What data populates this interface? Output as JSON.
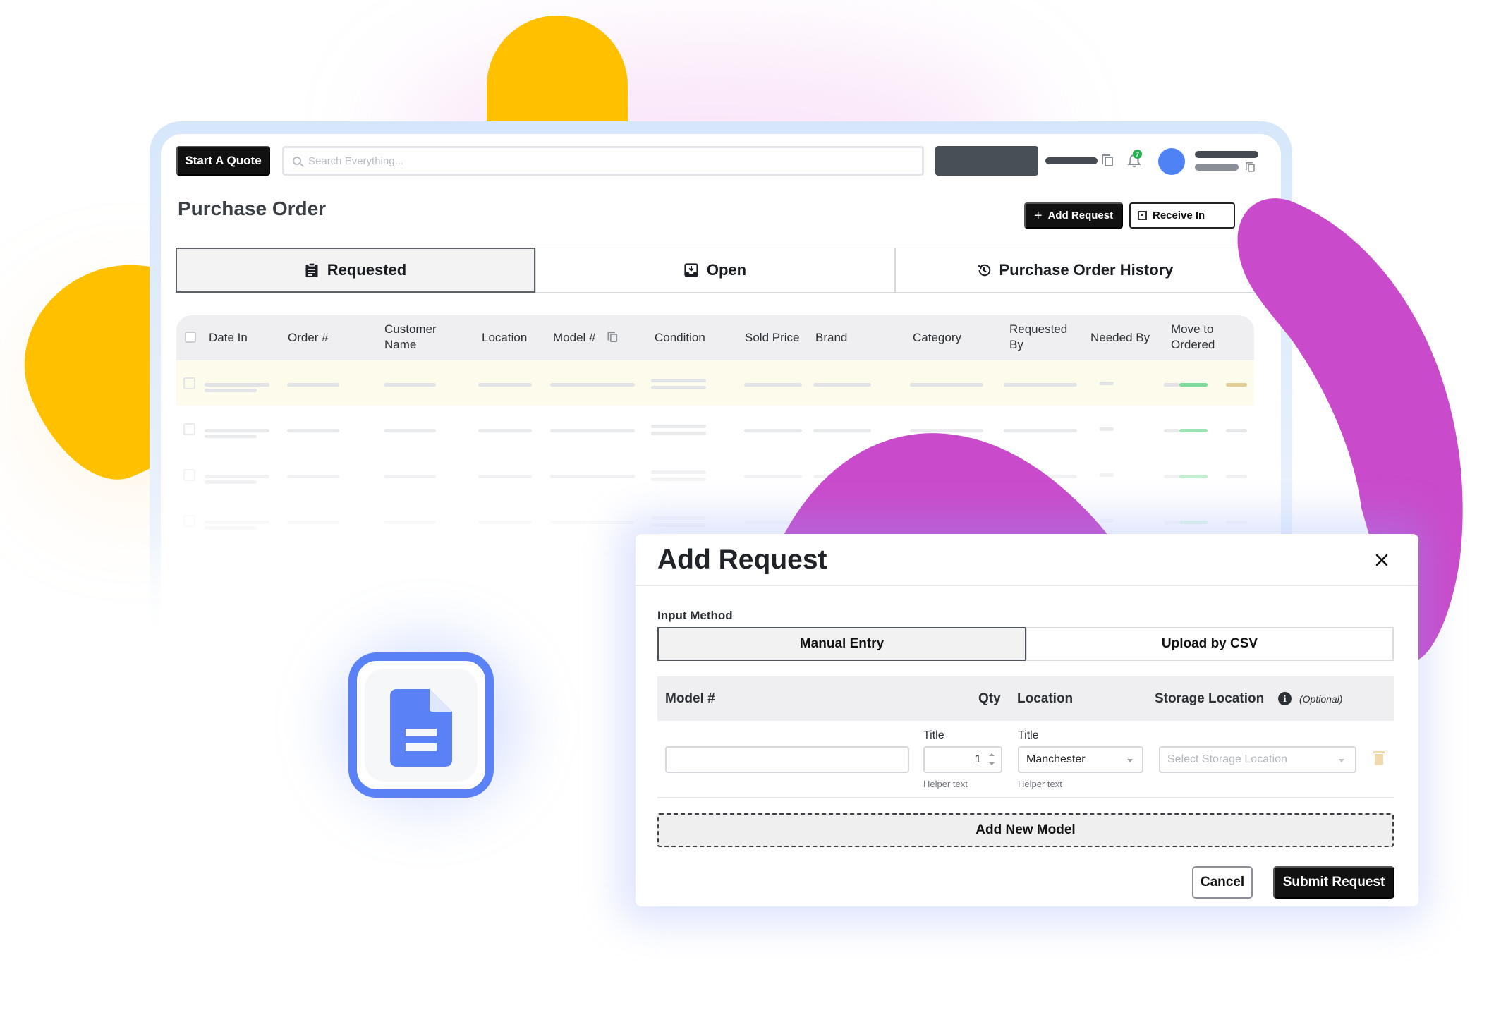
{
  "colors": {
    "accent_dark": "#111111",
    "brand_blue": "#5a82f6",
    "yellow_blob": "#ffc000",
    "purple_blob": "#c94bcb",
    "status_green": "#7ed99b",
    "notification_green": "#22b14c"
  },
  "topbar": {
    "start_quote_label": "Start A Quote",
    "search_placeholder": "Search Everything...",
    "notification_count": "7",
    "icons": [
      "search-icon",
      "copy-icon",
      "bell-icon"
    ]
  },
  "page": {
    "title": "Purchase Order",
    "add_request_label": "Add Request",
    "receive_label": "Receive Inventory",
    "receive_visible_label": "Receive In"
  },
  "tabs": [
    {
      "label": "Requested",
      "icon": "clipboard-icon",
      "active": true
    },
    {
      "label": "Open",
      "icon": "inbox-icon",
      "active": false
    },
    {
      "label": "Purchase Order History",
      "icon": "history-icon",
      "active": false
    }
  ],
  "table": {
    "columns": [
      "Date In",
      "Order #",
      "Customer Name",
      "Location",
      "Model #",
      "Condition",
      "Sold Price",
      "Brand",
      "Category",
      "Requested By",
      "Needed By",
      "Move to Ordered"
    ],
    "header_lines": {
      "customer_name": [
        "Customer",
        "Name"
      ],
      "requested_by": [
        "Requested",
        "By"
      ],
      "move_to_ordered": [
        "Move to",
        "Ordered"
      ]
    }
  },
  "modal": {
    "title": "Add Request",
    "input_method_label": "Input Method",
    "methods": [
      "Manual Entry",
      "Upload by CSV"
    ],
    "selected_method": "Manual Entry",
    "columns": {
      "model": "Model #",
      "qty": "Qty",
      "location": "Location",
      "storage_location": "Storage Location",
      "optional": "(Optional)"
    },
    "row": {
      "model_value": "",
      "qty_label": "Title",
      "qty_value": "1",
      "qty_helper": "Helper text",
      "location_label": "Title",
      "location_value": "Manchester",
      "location_helper": "Helper text",
      "storage_placeholder": "Select Storage Location"
    },
    "add_new_model_label": "Add New Model",
    "cancel_label": "Cancel",
    "submit_label": "Submit Request"
  }
}
